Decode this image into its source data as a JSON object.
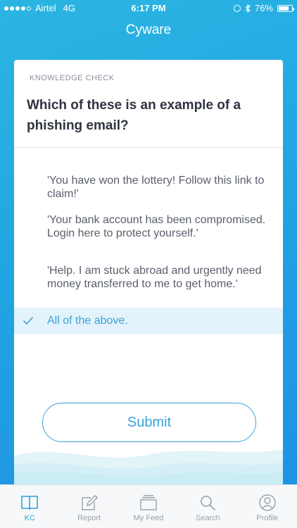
{
  "status_bar": {
    "carrier": "Airtel",
    "network": "4G",
    "time": "6:17 PM",
    "battery_percent": "76%",
    "battery_level": 0.76
  },
  "header": {
    "title": "Cyware"
  },
  "card": {
    "section_label": "KNOWLEDGE CHECK",
    "question": "Which of these is an example of a phishing email?",
    "options": [
      {
        "label": "'You have won the lottery! Follow this link to claim!'",
        "selected": false
      },
      {
        "label": "'Your bank account has been compromised. Login here to protect yourself.'",
        "selected": false
      },
      {
        "label": "'Help. I am stuck abroad and urgently need money transferred to me to get home.'",
        "selected": false
      },
      {
        "label": "All of the above.",
        "selected": true
      }
    ],
    "submit_label": "Submit"
  },
  "tabbar": {
    "tabs": [
      {
        "label": "KC",
        "icon": "book-icon",
        "active": true
      },
      {
        "label": "Report",
        "icon": "edit-icon",
        "active": false
      },
      {
        "label": "My Feed",
        "icon": "feed-icon",
        "active": false
      },
      {
        "label": "Search",
        "icon": "search-icon",
        "active": false
      },
      {
        "label": "Profile",
        "icon": "profile-icon",
        "active": false
      }
    ]
  },
  "colors": {
    "accent": "#3aa3d9",
    "header_gradient_start": "#2bb5e2",
    "header_gradient_end": "#1e8fe3",
    "selected_bg": "#e3f3fb"
  }
}
